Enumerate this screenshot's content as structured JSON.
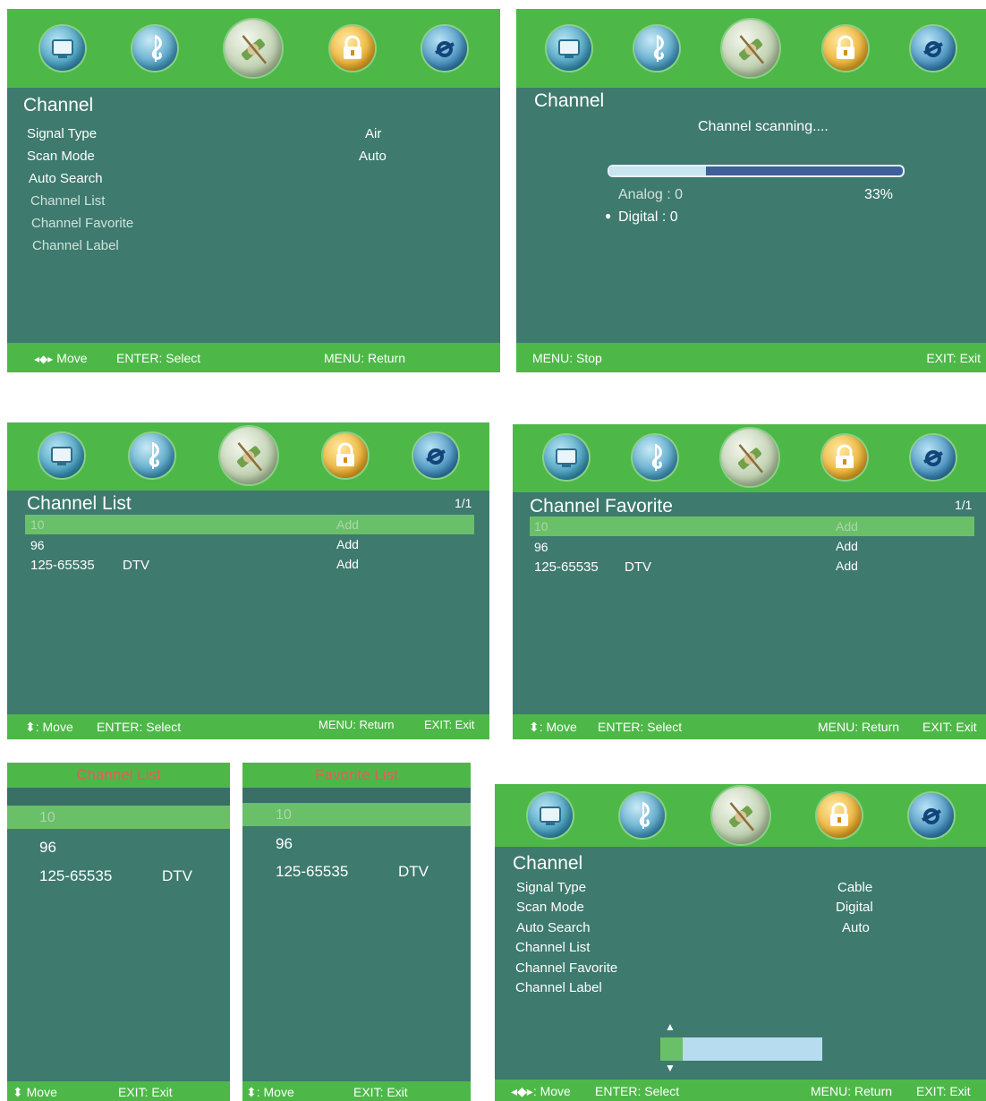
{
  "menu_icons": [
    "tv-picture-icon",
    "music-note-icon",
    "satellite-channel-icon",
    "padlock-icon",
    "settings-gear-icon"
  ],
  "colors": {
    "menu_green": "#4db848",
    "panel_teal": "#3e7a6e",
    "highlight_green": "#6abf69",
    "popup_title_red": "#e75b5b",
    "slider_blue": "#b7dcef"
  },
  "screen_channel_air": {
    "title": "Channel",
    "items": [
      {
        "label": "Signal Type",
        "value": "Air"
      },
      {
        "label": "Scan Mode",
        "value": "Auto"
      },
      {
        "label": "Auto Search",
        "value": ""
      },
      {
        "label": "Channel List",
        "value": ""
      },
      {
        "label": "Channel Favorite",
        "value": ""
      },
      {
        "label": "Channel Label",
        "value": ""
      }
    ],
    "footer": {
      "move": "Move",
      "enter": "ENTER: Select",
      "menu": "MENU: Return"
    }
  },
  "screen_scanning": {
    "title": "Channel",
    "status": "Channel scanning....",
    "progress_percent": 33,
    "progress_label": "33%",
    "analog": "Analog : 0",
    "digital": "Digital : 0",
    "footer": {
      "stop": "MENU: Stop",
      "exit": "EXIT: Exit"
    }
  },
  "screen_channel_list": {
    "title": "Channel List",
    "page": "1/1",
    "rows": [
      {
        "num": "10",
        "type": "",
        "action": "Add"
      },
      {
        "num": "96",
        "type": "",
        "action": "Add"
      },
      {
        "num": "125-65535",
        "type": "DTV",
        "action": "Add"
      }
    ],
    "footer": {
      "move": ": Move",
      "enter": "ENTER: Select",
      "menu": "MENU: Return",
      "exit": "EXIT: Exit"
    }
  },
  "screen_channel_favorite": {
    "title": "Channel Favorite",
    "page": "1/1",
    "rows": [
      {
        "num": "10",
        "type": "",
        "action": "Add"
      },
      {
        "num": "96",
        "type": "",
        "action": "Add"
      },
      {
        "num": "125-65535",
        "type": "DTV",
        "action": "Add"
      }
    ],
    "footer": {
      "move": ": Move",
      "enter": "ENTER: Select",
      "menu": "MENU: Return",
      "exit": "EXIT: Exit"
    }
  },
  "popup_channel_list": {
    "title": "Channel List",
    "rows": [
      {
        "num": "10",
        "type": ""
      },
      {
        "num": "96",
        "type": ""
      },
      {
        "num": "125-65535",
        "type": "DTV"
      }
    ],
    "footer": {
      "move": "Move",
      "exit": "EXIT: Exit"
    }
  },
  "popup_favorite_list": {
    "title": "Favorite List",
    "rows": [
      {
        "num": "10",
        "type": ""
      },
      {
        "num": "96",
        "type": ""
      },
      {
        "num": "125-65535",
        "type": "DTV"
      }
    ],
    "footer": {
      "move": ": Move",
      "exit": "EXIT: Exit"
    }
  },
  "screen_channel_cable": {
    "title": "Channel",
    "items": [
      {
        "label": "Signal Type",
        "value": "Cable"
      },
      {
        "label": "Scan Mode",
        "value": "Digital"
      },
      {
        "label": "Auto Search",
        "value": "Auto"
      },
      {
        "label": "Channel List",
        "value": ""
      },
      {
        "label": "Channel Favorite",
        "value": ""
      },
      {
        "label": "Channel Label",
        "value": ""
      }
    ],
    "slider_fraction": 0.14,
    "footer": {
      "move": ": Move",
      "enter": "ENTER: Select",
      "menu": "MENU: Return",
      "exit": "EXIT: Exit"
    }
  }
}
